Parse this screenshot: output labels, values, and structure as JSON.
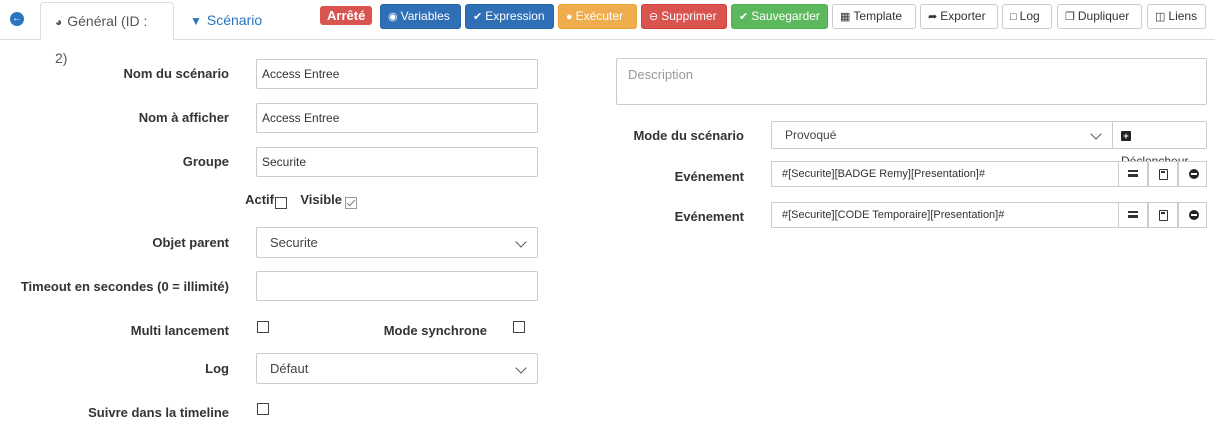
{
  "header": {
    "tabs": [
      {
        "label": "Général (ID : 2)",
        "icon": "dashboard-icon"
      },
      {
        "label": "Scénario",
        "icon": "filter-icon"
      }
    ],
    "status_badge": "Arrêté",
    "buttons": {
      "variables": "Variables",
      "expression": "Expression",
      "executer": "Exécuter",
      "supprimer": "Supprimer",
      "sauvegarder": "Sauvegarder",
      "template": "Template",
      "exporter": "Exporter",
      "log": "Log",
      "dupliquer": "Dupliquer",
      "liens": "Liens"
    }
  },
  "form_left": {
    "nom_scenario": {
      "label": "Nom du scénario",
      "value": "Access Entree"
    },
    "nom_afficher": {
      "label": "Nom à afficher",
      "value": "Access Entree"
    },
    "groupe": {
      "label": "Groupe",
      "value": "Securite"
    },
    "actif": {
      "label": "Actif",
      "checked": false
    },
    "visible": {
      "label": "Visible",
      "checked": true
    },
    "objet_parent": {
      "label": "Objet parent",
      "value": "Securite"
    },
    "timeout": {
      "label": "Timeout en secondes (0 = illimité)",
      "value": ""
    },
    "multi_lancement": {
      "label": "Multi lancement",
      "checked": false
    },
    "mode_synchrone": {
      "label": "Mode synchrone",
      "checked": false
    },
    "log": {
      "label": "Log",
      "value": "Défaut"
    },
    "suivre_timeline": {
      "label": "Suivre dans la timeline",
      "checked": false
    }
  },
  "form_right": {
    "description": {
      "placeholder": "Description"
    },
    "mode": {
      "label": "Mode du scénario",
      "value": "Provoqué",
      "declencheur_label": "Déclencheur"
    },
    "events": [
      {
        "label": "Evénement",
        "value": "#[Securite][BADGE Remy][Presentation]#"
      },
      {
        "label": "Evénement",
        "value": "#[Securite][CODE Temporaire][Presentation]#"
      }
    ]
  },
  "colors": {
    "primary_blue": "#2f6fb5",
    "danger_red": "#d9534f",
    "warning_orange": "#f0ad4e",
    "success_green": "#5cb85c"
  }
}
